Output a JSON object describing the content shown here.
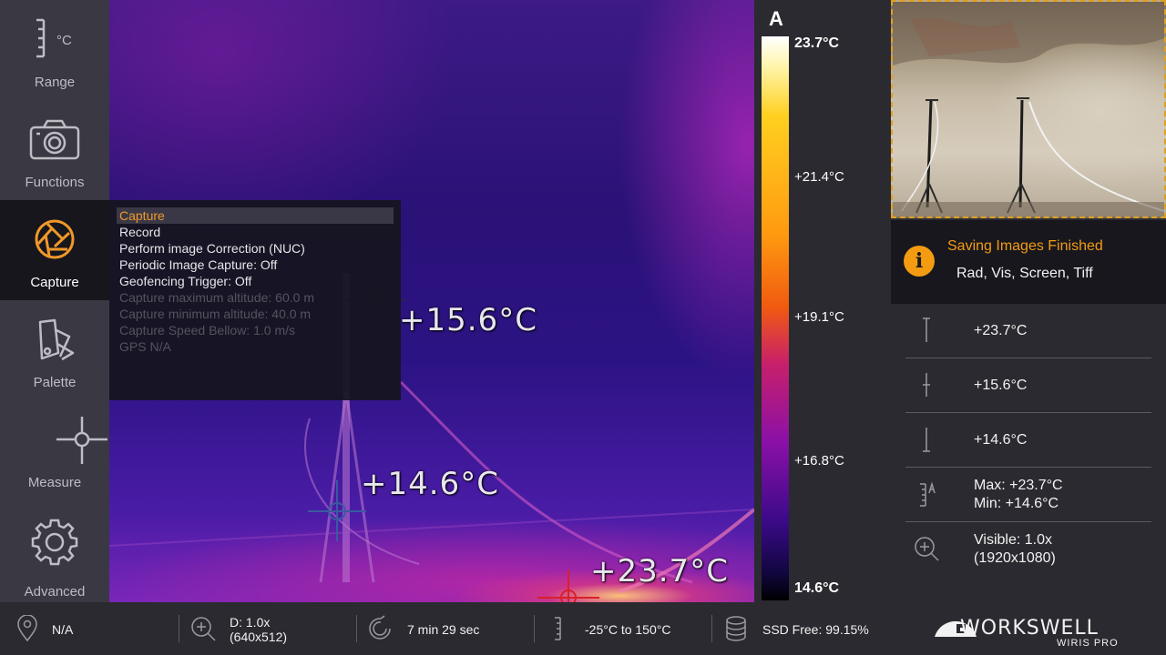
{
  "sidebar": {
    "items": [
      {
        "label": "Range",
        "icon": "range-scale-icon"
      },
      {
        "label": "Functions",
        "icon": "camera-icon"
      },
      {
        "label": "Capture",
        "icon": "aperture-icon",
        "active": true
      },
      {
        "label": "Palette",
        "icon": "palette-swatch-icon"
      },
      {
        "label": "Measure",
        "icon": "crosshair-icon"
      },
      {
        "label": "Advanced",
        "icon": "gear-icon"
      }
    ],
    "range_unit": "°C"
  },
  "capture_menu": {
    "items": [
      {
        "label": "Capture",
        "state": "selected"
      },
      {
        "label": "Record",
        "state": "enabled"
      },
      {
        "label": "Perform image Correction (NUC)",
        "state": "enabled"
      },
      {
        "label": "Periodic Image Capture: Off",
        "state": "enabled"
      },
      {
        "label": "Geofencing Trigger: Off",
        "state": "enabled"
      },
      {
        "label": "Capture maximum altitude: 60.0 m",
        "state": "disabled"
      },
      {
        "label": "Capture minimum altitude: 40.0 m",
        "state": "disabled"
      },
      {
        "label": "Capture Speed Bellow: 1.0 m/s",
        "state": "disabled"
      },
      {
        "label": "GPS N/A",
        "state": "disabled"
      }
    ]
  },
  "thermal": {
    "spots": [
      {
        "label": "+15.6°C",
        "type": "center"
      },
      {
        "label": "+14.6°C",
        "type": "min"
      },
      {
        "label": "+23.7°C",
        "type": "max"
      }
    ]
  },
  "scale": {
    "mode": "A",
    "labels": [
      "23.7°C",
      "+21.4°C",
      "+19.1°C",
      "+16.8°C",
      "14.6°C"
    ],
    "max": 23.7,
    "min": 14.6
  },
  "notice": {
    "title": "Saving Images Finished",
    "subtitle": "Rad, Vis, Screen, Tiff",
    "icon": "info-icon",
    "accent": "#f39c12"
  },
  "measurements": {
    "max_value": "+23.7°C",
    "center_value": "+15.6°C",
    "min_value": "+14.6°C",
    "range_max": "Max: +23.7°C",
    "range_min": "Min: +14.6°C",
    "visible_zoom": "Visible: 1.0x",
    "visible_res": "(1920x1080)"
  },
  "statusbar": {
    "gps": "N/A",
    "zoom": "D: 1.0x",
    "zoom_res": "(640x512)",
    "timer": "7 min 29 sec",
    "range": "-25°C to 150°C",
    "storage": "SSD Free: 99.15%"
  },
  "brand": {
    "name": "WORKSWELL",
    "sub": "WIRIS PRO"
  }
}
